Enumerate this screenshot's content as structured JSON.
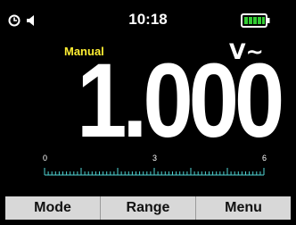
{
  "status": {
    "time": "10:18",
    "icons": [
      "timer-icon",
      "speaker-icon",
      "battery-icon"
    ],
    "battery_level": 1.0,
    "battery_color": "#33cc33"
  },
  "display": {
    "mode": "Manual",
    "unit": "V~",
    "reading": "1.000",
    "mode_color": "#ffee33"
  },
  "scale": {
    "labels": [
      "0",
      "3",
      "6"
    ],
    "color": "#4fd3d3"
  },
  "softkeys": [
    "Mode",
    "Range",
    "Menu"
  ]
}
